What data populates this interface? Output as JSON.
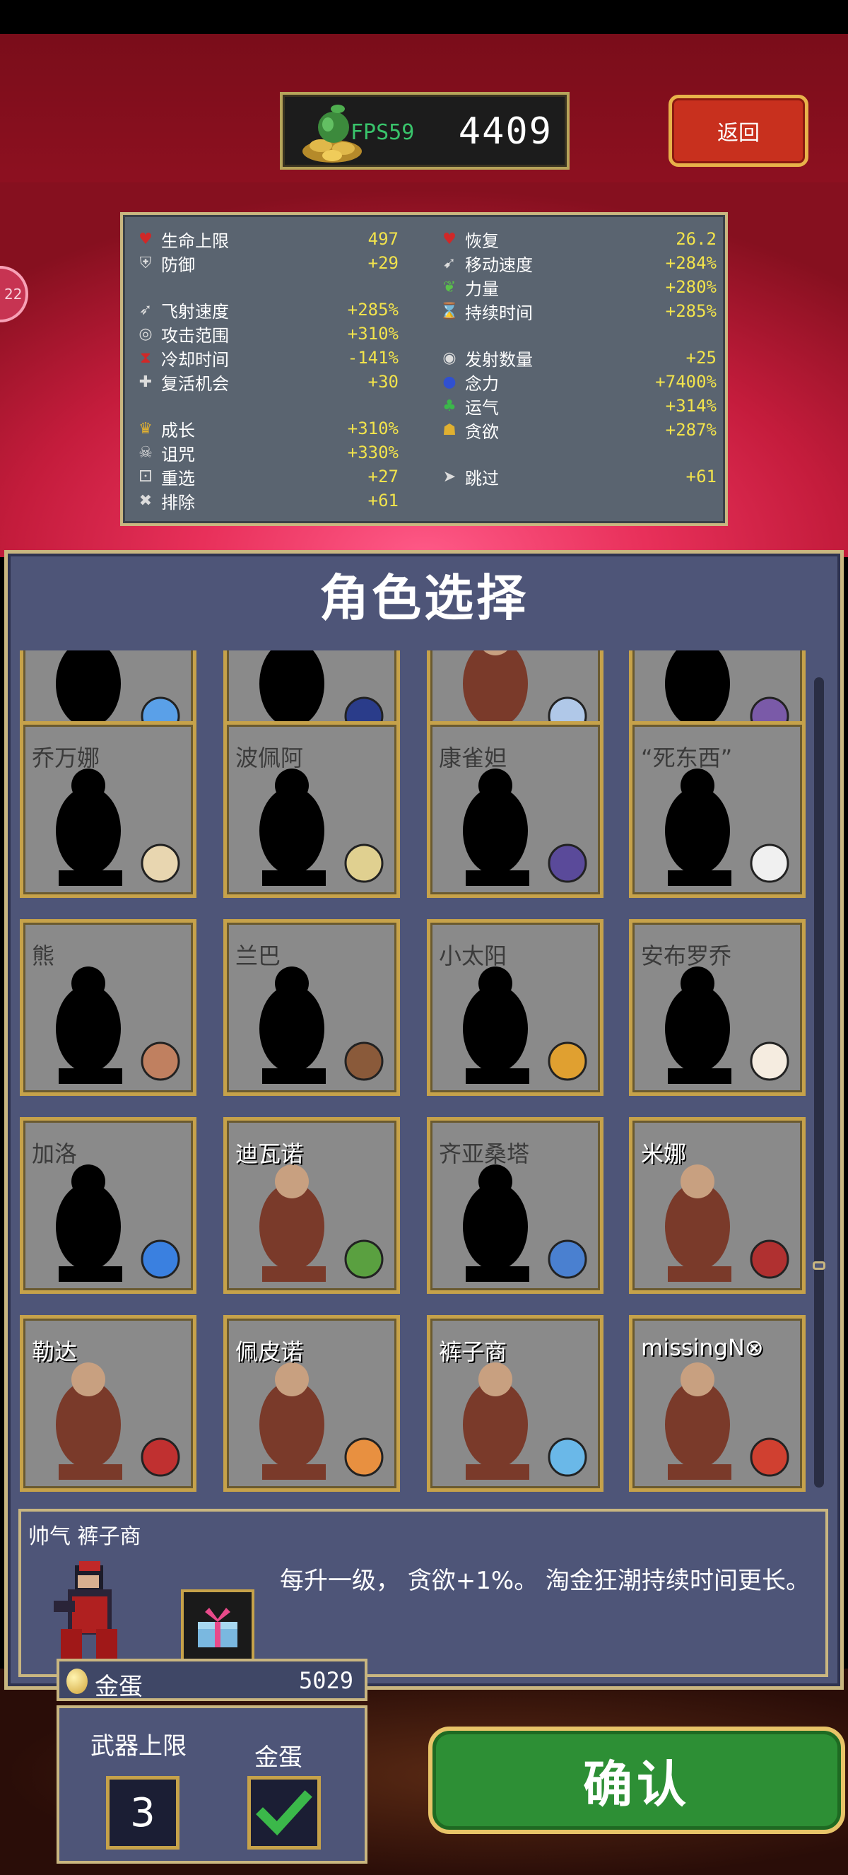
{
  "header": {
    "fps_label": "FPS59",
    "gold": "4409",
    "back_label": "返回",
    "side_badge": "22"
  },
  "stats": [
    {
      "label": "生命上限",
      "value": "497",
      "icon": "heart-icon"
    },
    {
      "label": "防御",
      "value": "+29",
      "icon": "armor-icon"
    },
    {
      "label": "飞射速度",
      "value": "+285%",
      "icon": "speed-icon"
    },
    {
      "label": "攻击范围",
      "value": "+310%",
      "icon": "area-icon"
    },
    {
      "label": "冷却时间",
      "value": "-141%",
      "icon": "cooldown-icon"
    },
    {
      "label": "复活机会",
      "value": "+30",
      "icon": "revival-icon"
    },
    {
      "label": "成长",
      "value": "+310%",
      "icon": "crown-icon"
    },
    {
      "label": "诅咒",
      "value": "+330%",
      "icon": "skull-icon"
    },
    {
      "label": "重选",
      "value": "+27",
      "icon": "dice-icon"
    },
    {
      "label": "排除",
      "value": "+61",
      "icon": "banish-icon"
    },
    {
      "label": "恢复",
      "value": "26.2",
      "icon": "recovery-icon"
    },
    {
      "label": "移动速度",
      "value": "+284%",
      "icon": "wing-icon"
    },
    {
      "label": "力量",
      "value": "+280%",
      "icon": "leaf-icon"
    },
    {
      "label": "持续时间",
      "value": "+285%",
      "icon": "duration-icon"
    },
    {
      "label": "发射数量",
      "value": "+25",
      "icon": "amount-icon"
    },
    {
      "label": "念力",
      "value": "+7400%",
      "icon": "orb-icon"
    },
    {
      "label": "运气",
      "value": "+314%",
      "icon": "clover-icon"
    },
    {
      "label": "贪欲",
      "value": "+287%",
      "icon": "greed-icon"
    },
    {
      "label": "跳过",
      "value": "+61",
      "icon": "skip-icon"
    }
  ],
  "title": "角色选择",
  "characters": [
    {
      "name": "",
      "unlocked": false,
      "item_color": "#5aa0e8"
    },
    {
      "name": "",
      "unlocked": false,
      "item_color": "#2a3c8a"
    },
    {
      "name": "",
      "unlocked": true,
      "item_color": "#b0c8e8"
    },
    {
      "name": "",
      "unlocked": false,
      "item_color": "#7a5aa8"
    },
    {
      "name": "乔万娜",
      "unlocked": false,
      "item_color": "#e8d6b0"
    },
    {
      "name": "波佩阿",
      "unlocked": false,
      "item_color": "#e0d090"
    },
    {
      "name": "康雀妲",
      "unlocked": false,
      "item_color": "#5a4a9a"
    },
    {
      "name": "“死东西”",
      "unlocked": false,
      "item_color": "#f0f0f0"
    },
    {
      "name": "熊",
      "unlocked": false,
      "item_color": "#c08060"
    },
    {
      "name": "兰巴",
      "unlocked": false,
      "item_color": "#8a5a3a"
    },
    {
      "name": "小太阳",
      "unlocked": false,
      "item_color": "#e0a030"
    },
    {
      "name": "安布罗乔",
      "unlocked": false,
      "item_color": "#f5ece0"
    },
    {
      "name": "加洛",
      "unlocked": false,
      "item_color": "#3a80e0"
    },
    {
      "name": "迪瓦诺",
      "unlocked": true,
      "item_color": "#5aa040"
    },
    {
      "name": "齐亚桑塔",
      "unlocked": false,
      "item_color": "#4a80d0"
    },
    {
      "name": "米娜",
      "unlocked": true,
      "item_color": "#b03030"
    },
    {
      "name": "勒达",
      "unlocked": true,
      "item_color": "#c03030"
    },
    {
      "name": "佩皮诺",
      "unlocked": true,
      "item_color": "#e89040"
    },
    {
      "name": "裤子商",
      "unlocked": true,
      "item_color": "#6ab8e8"
    },
    {
      "name": "missingN⊗",
      "unlocked": true,
      "item_color": "#d04030"
    }
  ],
  "selected": {
    "title": "帅气 裤子商",
    "description": "每升一级， 贪欲+1%。 淘金狂潮持续时间更长。"
  },
  "golden_egg": {
    "label": "金蛋",
    "value": "5029"
  },
  "options": {
    "weapon_limit_label": "武器上限",
    "weapon_limit_value": "3",
    "golden_egg_label": "金蛋",
    "golden_egg_enabled": true
  },
  "confirm_label": "确认"
}
